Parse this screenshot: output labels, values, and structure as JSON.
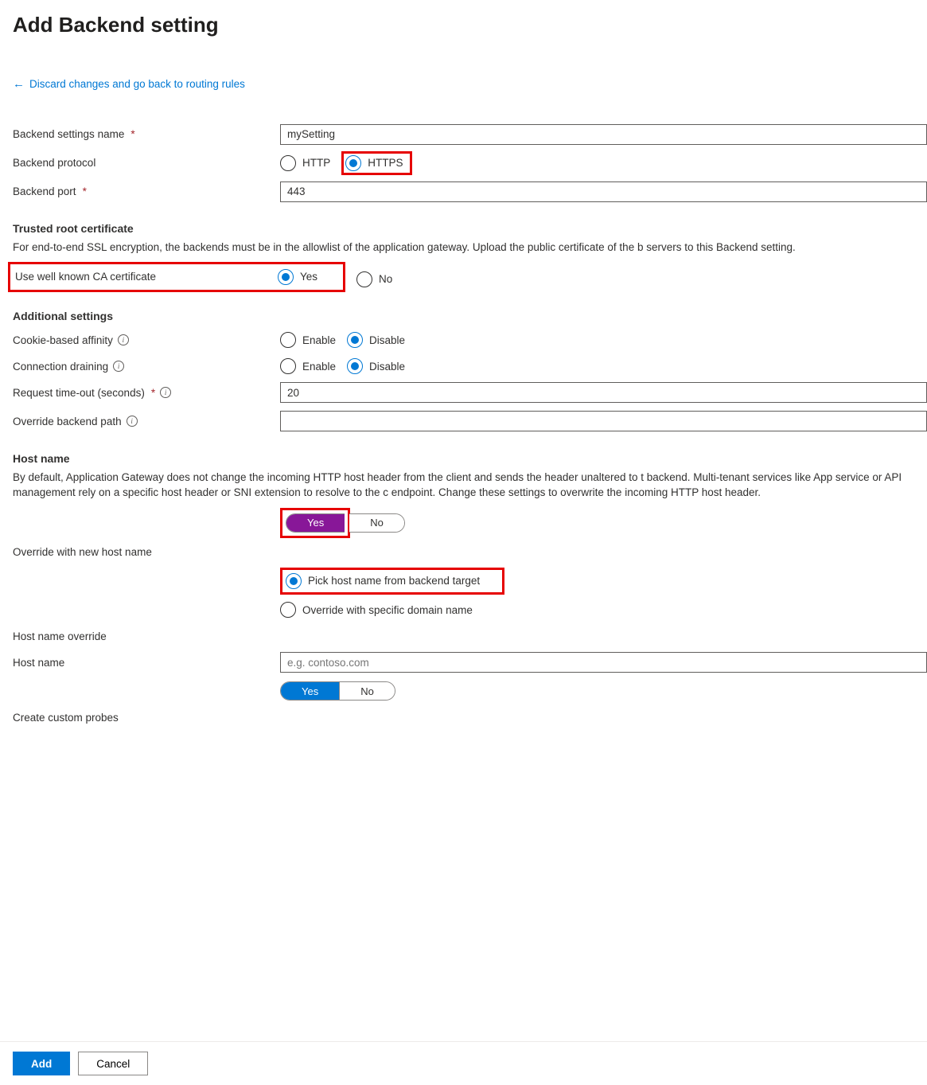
{
  "title": "Add Backend setting",
  "backLink": "Discard changes and go back to routing rules",
  "fields": {
    "settingsName": {
      "label": "Backend settings name",
      "value": "mySetting"
    },
    "protocol": {
      "label": "Backend protocol",
      "http": "HTTP",
      "https": "HTTPS"
    },
    "port": {
      "label": "Backend port",
      "value": "443"
    }
  },
  "trusted": {
    "title": "Trusted root certificate",
    "desc": "For end-to-end SSL encryption, the backends must be in the allowlist of the application gateway. Upload the public certificate of the b servers to this Backend setting.",
    "caLabel": "Use well known CA certificate",
    "yes": "Yes",
    "no": "No"
  },
  "additional": {
    "title": "Additional settings",
    "cookie": {
      "label": "Cookie-based affinity",
      "enable": "Enable",
      "disable": "Disable"
    },
    "drain": {
      "label": "Connection draining",
      "enable": "Enable",
      "disable": "Disable"
    },
    "timeout": {
      "label": "Request time-out (seconds)",
      "value": "20"
    },
    "override": {
      "label": "Override backend path",
      "value": ""
    }
  },
  "hostname": {
    "title": "Host name",
    "desc": "By default, Application Gateway does not change the incoming HTTP host header from the client and sends the header unaltered to t backend. Multi-tenant services like App service or API management rely on a specific host header or SNI extension to resolve to the c endpoint. Change these settings to overwrite the incoming HTTP host header.",
    "toggleYes": "Yes",
    "toggleNo": "No",
    "overrideLabel": "Override with new host name",
    "optPick": "Pick host name from backend target",
    "optSpecific": "Override with specific domain name",
    "hostOverrideLabel": "Host name override",
    "hostLabel": "Host name",
    "hostPlaceholder": "e.g. contoso.com",
    "probesLabel": "Create custom probes",
    "probesYes": "Yes",
    "probesNo": "No"
  },
  "footer": {
    "add": "Add",
    "cancel": "Cancel"
  }
}
